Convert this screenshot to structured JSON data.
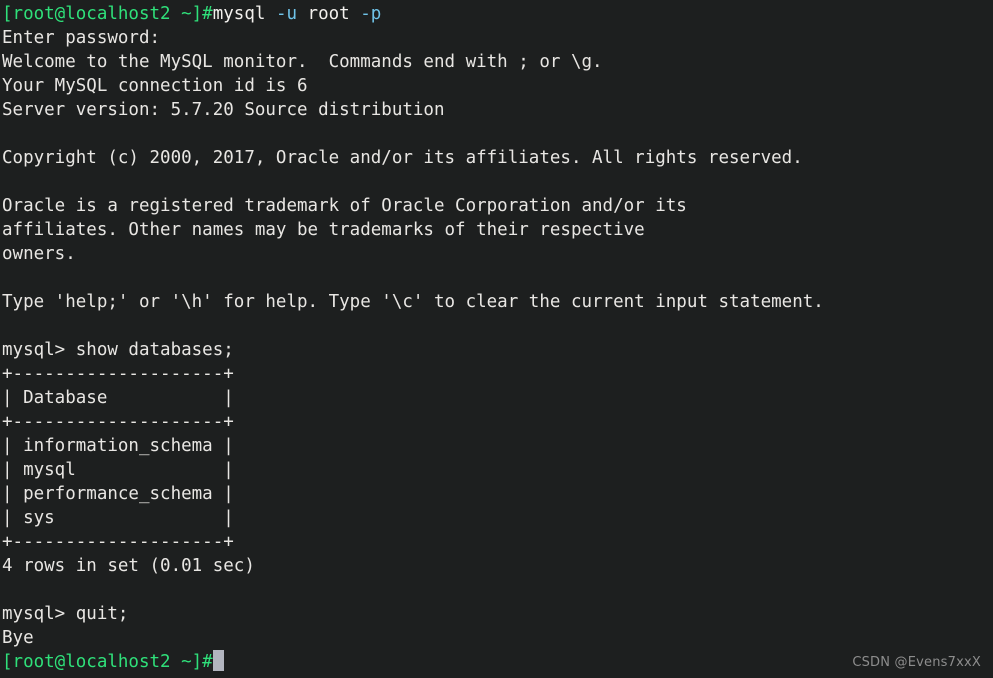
{
  "terminal": {
    "background_color": "#1d1f1f",
    "foreground_color": "#e8e6e3",
    "prompt_color": "#2fe07a",
    "flag_color": "#6fc3e8",
    "cursor_color": "#b2b5bf",
    "lines": [
      {
        "id": "line-command-mysql",
        "kind": "command",
        "segments": [
          {
            "text": "[root@localhost2 ~]#",
            "style": "seg-prompt"
          },
          {
            "text": "mysql ",
            "style": "seg-white"
          },
          {
            "text": "-u ",
            "style": "seg-flag"
          },
          {
            "text": "root ",
            "style": "seg-white"
          },
          {
            "text": "-p",
            "style": "seg-flag"
          }
        ]
      },
      {
        "id": "line-enter-password",
        "kind": "output",
        "segments": [
          {
            "text": "Enter password:",
            "style": "seg-default"
          }
        ]
      },
      {
        "id": "line-welcome",
        "kind": "output",
        "segments": [
          {
            "text": "Welcome to the MySQL monitor.  Commands end with ; or \\g.",
            "style": "seg-default"
          }
        ]
      },
      {
        "id": "line-connection-id",
        "kind": "output",
        "segments": [
          {
            "text": "Your MySQL connection id is 6",
            "style": "seg-default"
          }
        ]
      },
      {
        "id": "line-server-version",
        "kind": "output",
        "segments": [
          {
            "text": "Server version: 5.7.20 Source distribution",
            "style": "seg-default"
          }
        ]
      },
      {
        "id": "line-blank-1",
        "kind": "blank",
        "segments": [
          {
            "text": " ",
            "style": "seg-default"
          }
        ]
      },
      {
        "id": "line-copyright",
        "kind": "output",
        "segments": [
          {
            "text": "Copyright (c) 2000, 2017, Oracle and/or its affiliates. All rights reserved.",
            "style": "seg-default"
          }
        ]
      },
      {
        "id": "line-blank-2",
        "kind": "blank",
        "segments": [
          {
            "text": " ",
            "style": "seg-default"
          }
        ]
      },
      {
        "id": "line-trademark-1",
        "kind": "output",
        "segments": [
          {
            "text": "Oracle is a registered trademark of Oracle Corporation and/or its",
            "style": "seg-default"
          }
        ]
      },
      {
        "id": "line-trademark-2",
        "kind": "output",
        "segments": [
          {
            "text": "affiliates. Other names may be trademarks of their respective",
            "style": "seg-default"
          }
        ]
      },
      {
        "id": "line-trademark-3",
        "kind": "output",
        "segments": [
          {
            "text": "owners.",
            "style": "seg-default"
          }
        ]
      },
      {
        "id": "line-blank-3",
        "kind": "blank",
        "segments": [
          {
            "text": " ",
            "style": "seg-default"
          }
        ]
      },
      {
        "id": "line-help-hint",
        "kind": "output",
        "segments": [
          {
            "text": "Type 'help;' or '\\h' for help. Type '\\c' to clear the current input statement.",
            "style": "seg-default"
          }
        ]
      },
      {
        "id": "line-blank-4",
        "kind": "blank",
        "segments": [
          {
            "text": " ",
            "style": "seg-default"
          }
        ]
      },
      {
        "id": "line-command-show-databases",
        "kind": "command",
        "segments": [
          {
            "text": "mysql> show databases;",
            "style": "seg-default"
          }
        ]
      },
      {
        "id": "line-table-top-border",
        "kind": "table",
        "segments": [
          {
            "text": "+--------------------+",
            "style": "seg-default"
          }
        ]
      },
      {
        "id": "line-table-header",
        "kind": "table",
        "segments": [
          {
            "text": "| Database           |",
            "style": "seg-default"
          }
        ]
      },
      {
        "id": "line-table-header-border",
        "kind": "table",
        "segments": [
          {
            "text": "+--------------------+",
            "style": "seg-default"
          }
        ]
      },
      {
        "id": "line-table-row-information-schema",
        "kind": "table",
        "segments": [
          {
            "text": "| information_schema |",
            "style": "seg-default"
          }
        ]
      },
      {
        "id": "line-table-row-mysql",
        "kind": "table",
        "segments": [
          {
            "text": "| mysql              |",
            "style": "seg-default"
          }
        ]
      },
      {
        "id": "line-table-row-performance-schema",
        "kind": "table",
        "segments": [
          {
            "text": "| performance_schema |",
            "style": "seg-default"
          }
        ]
      },
      {
        "id": "line-table-row-sys",
        "kind": "table",
        "segments": [
          {
            "text": "| sys                |",
            "style": "seg-default"
          }
        ]
      },
      {
        "id": "line-table-bottom-border",
        "kind": "table",
        "segments": [
          {
            "text": "+--------------------+",
            "style": "seg-default"
          }
        ]
      },
      {
        "id": "line-rows-in-set",
        "kind": "output",
        "segments": [
          {
            "text": "4 rows in set (0.01 sec)",
            "style": "seg-default"
          }
        ]
      },
      {
        "id": "line-blank-5",
        "kind": "blank",
        "segments": [
          {
            "text": " ",
            "style": "seg-default"
          }
        ]
      },
      {
        "id": "line-command-quit",
        "kind": "command",
        "segments": [
          {
            "text": "mysql> quit;",
            "style": "seg-default"
          }
        ]
      },
      {
        "id": "line-bye",
        "kind": "output",
        "segments": [
          {
            "text": "Bye",
            "style": "seg-default"
          }
        ]
      },
      {
        "id": "line-final-prompt",
        "kind": "prompt",
        "cursor": true,
        "segments": [
          {
            "text": "[root@localhost2 ~]#",
            "style": "seg-prompt"
          }
        ]
      }
    ],
    "table": {
      "columns": [
        "Database"
      ],
      "rows": [
        [
          "information_schema"
        ],
        [
          "mysql"
        ],
        [
          "performance_schema"
        ],
        [
          "sys"
        ]
      ],
      "row_count_text": "4 rows in set (0.01 sec)"
    }
  },
  "watermark": {
    "text": "CSDN @Evens7xxX"
  }
}
